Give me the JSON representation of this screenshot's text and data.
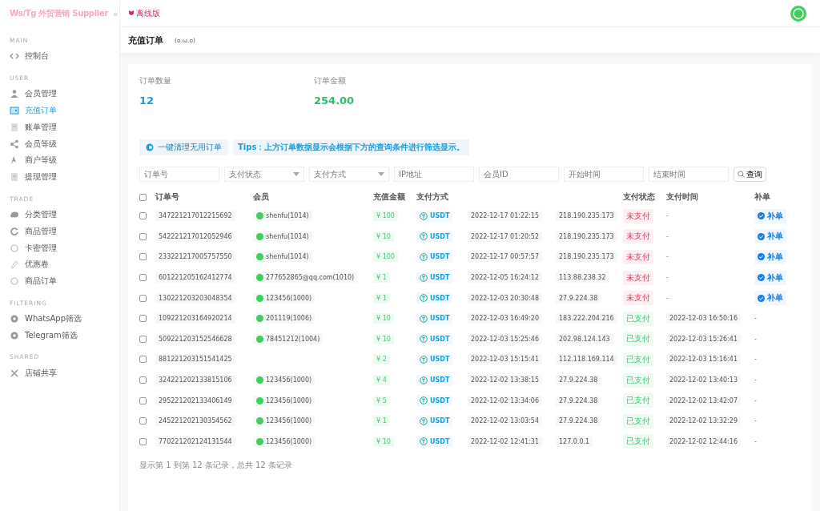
{
  "sidebar": {
    "brand": "Ws/Tg 外贸营销 Supplier",
    "collapse": "«",
    "sections": [
      {
        "title": "MAIN",
        "items": [
          {
            "label": "控制台",
            "selected": false
          }
        ]
      },
      {
        "title": "USER",
        "items": [
          {
            "label": "会员管理",
            "selected": false
          },
          {
            "label": "充值订单",
            "selected": true
          },
          {
            "label": "账单管理",
            "selected": false
          },
          {
            "label": "会员等级",
            "selected": false
          },
          {
            "label": "商户等级",
            "selected": false
          },
          {
            "label": "提现管理",
            "selected": false
          }
        ]
      },
      {
        "title": "TRADE",
        "items": [
          {
            "label": "分类管理",
            "selected": false
          },
          {
            "label": "商品管理",
            "selected": false
          },
          {
            "label": "卡密管理",
            "selected": false
          },
          {
            "label": "优惠卷",
            "selected": false
          },
          {
            "label": "商品订单",
            "selected": false
          }
        ]
      },
      {
        "title": "FILTERING",
        "items": [
          {
            "label": "WhatsApp筛选",
            "selected": false
          },
          {
            "label": "Telegram筛选",
            "selected": false
          }
        ]
      },
      {
        "title": "SHARED",
        "items": [
          {
            "label": "店铺共享",
            "selected": false
          }
        ]
      }
    ]
  },
  "topbar": {
    "badge": "离线版"
  },
  "page": {
    "title": "充值订单",
    "emoticon": "(o.ω.o)"
  },
  "stats": [
    {
      "label": "订单数量",
      "value": "12",
      "color": "#1a9ee0"
    },
    {
      "label": "订单金额",
      "value": "254.00",
      "color": "#2ebd6b"
    }
  ],
  "actions": {
    "clean_button": "一键清理无用订单",
    "tips": "Tips：上方订单数据显示会根据下方的查询条件进行筛选显示。"
  },
  "filters": [
    {
      "kind": "input",
      "placeholder": "订单号"
    },
    {
      "kind": "select",
      "placeholder": "支付状态"
    },
    {
      "kind": "select",
      "placeholder": "支付方式"
    },
    {
      "kind": "input",
      "placeholder": "IP地址"
    },
    {
      "kind": "input",
      "placeholder": "会员ID"
    },
    {
      "kind": "input",
      "placeholder": "开始时间"
    },
    {
      "kind": "input",
      "placeholder": "结束时间"
    }
  ],
  "search_button": "查询",
  "table": {
    "all_checked": false,
    "columns": [
      "订单号",
      "会员",
      "充值金额",
      "支付方式",
      "",
      "",
      "支付状态",
      "支付时间",
      "补单"
    ],
    "rows": [
      {
        "checked": false,
        "order": "347221217012215692",
        "member": "shenfu(1014)",
        "amount": "¥ 100",
        "method": "USDT",
        "created": "2022-12-17 01:22:15",
        "ip": "218.190.235.173",
        "status": "未支付",
        "paid": false,
        "pay_time": "-",
        "fix": "补单"
      },
      {
        "checked": false,
        "order": "542221217012052946",
        "member": "shenfu(1014)",
        "amount": "¥ 10",
        "method": "USDT",
        "created": "2022-12-17 01:20:52",
        "ip": "218.190.235.173",
        "status": "未支付",
        "paid": false,
        "pay_time": "-",
        "fix": "补单"
      },
      {
        "checked": false,
        "order": "233221217005757550",
        "member": "shenfu(1014)",
        "amount": "¥ 100",
        "method": "USDT",
        "created": "2022-12-17 00:57:57",
        "ip": "218.190.235.173",
        "status": "未支付",
        "paid": false,
        "pay_time": "-",
        "fix": "补单"
      },
      {
        "checked": false,
        "order": "601221205162412774",
        "member": "277652865@qq.com(1010)",
        "amount": "¥ 1",
        "method": "USDT",
        "created": "2022-12-05 16:24:12",
        "ip": "113.88.238.32",
        "status": "未支付",
        "paid": false,
        "pay_time": "-",
        "fix": "补单"
      },
      {
        "checked": false,
        "order": "130221203203048354",
        "member": "123456(1000)",
        "amount": "¥ 1",
        "method": "USDT",
        "created": "2022-12-03 20:30:48",
        "ip": "27.9.224.38",
        "status": "未支付",
        "paid": false,
        "pay_time": "-",
        "fix": "补单"
      },
      {
        "checked": false,
        "order": "109221203164920214",
        "member": "201119(1006)",
        "amount": "¥ 10",
        "method": "USDT",
        "created": "2022-12-03 16:49:20",
        "ip": "183.222.204.216",
        "status": "已支付",
        "paid": true,
        "pay_time": "2022-12-03 16:50:16",
        "fix": "-"
      },
      {
        "checked": false,
        "order": "509221203152546628",
        "member": "78451212(1004)",
        "amount": "¥ 10",
        "method": "USDT",
        "created": "2022-12-03 15:25:46",
        "ip": "202.98.124.143",
        "status": "已支付",
        "paid": true,
        "pay_time": "2022-12-03 15:26:41",
        "fix": "-"
      },
      {
        "checked": false,
        "order": "881221203151541425",
        "amount": "¥ 2",
        "method": "USDT",
        "created": "2022-12-03 15:15:41",
        "ip": "112.118.169.114",
        "status": "已支付",
        "paid": true,
        "pay_time": "2022-12-03 15:16:41",
        "fix": "-"
      },
      {
        "checked": false,
        "order": "324221202133815106",
        "member": "123456(1000)",
        "amount": "¥ 4",
        "method": "USDT",
        "created": "2022-12-02 13:38:15",
        "ip": "27.9.224.38",
        "status": "已支付",
        "paid": true,
        "pay_time": "2022-12-02 13:40:13",
        "fix": "-"
      },
      {
        "checked": false,
        "order": "295221202133406149",
        "member": "123456(1000)",
        "amount": "¥ 5",
        "method": "USDT",
        "created": "2022-12-02 13:34:06",
        "ip": "27.9.224.38",
        "status": "已支付",
        "paid": true,
        "pay_time": "2022-12-02 13:42:07",
        "fix": "-"
      },
      {
        "checked": false,
        "order": "245221202130354562",
        "member": "123456(1000)",
        "amount": "¥ 1",
        "method": "USDT",
        "created": "2022-12-02 13:03:54",
        "ip": "27.9.224.38",
        "status": "已支付",
        "paid": true,
        "pay_time": "2022-12-02 13:32:29",
        "fix": "-"
      },
      {
        "checked": false,
        "order": "770221202124131544",
        "member": "123456(1000)",
        "amount": "¥ 10",
        "method": "USDT",
        "created": "2022-12-02 12:41:31",
        "ip": "127.0.0.1",
        "status": "已支付",
        "paid": true,
        "pay_time": "2022-12-02 12:44:16",
        "fix": "-"
      }
    ]
  },
  "footer": "显示第 1 到第 12 条记录，总共 12 条记录"
}
